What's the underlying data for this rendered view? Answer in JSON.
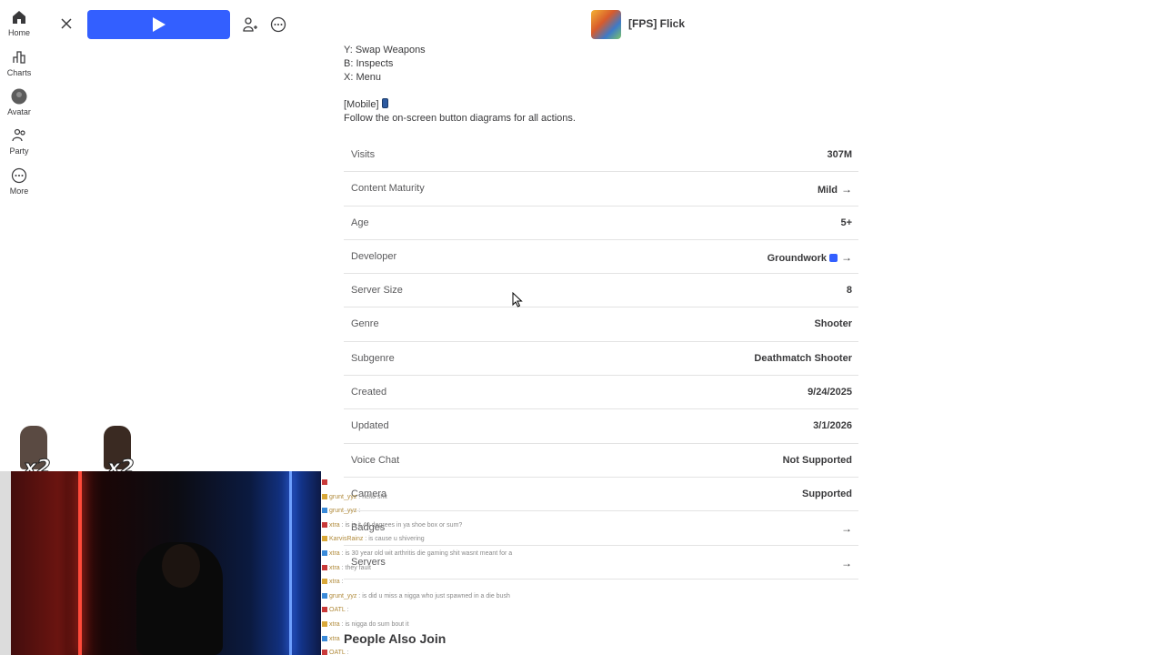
{
  "nav": {
    "items": [
      {
        "label": "Home",
        "icon": "home-icon"
      },
      {
        "label": "Charts",
        "icon": "charts-icon"
      },
      {
        "label": "Avatar",
        "icon": "avatar-icon"
      },
      {
        "label": "Party",
        "icon": "party-icon"
      },
      {
        "label": "More",
        "icon": "more-icon"
      }
    ]
  },
  "topbar": {
    "game_title": "[FPS] Flick",
    "play_color": "#335fff"
  },
  "description": {
    "lines": [
      "Y: Swap Weapons",
      "B: Inspects",
      "X: Menu",
      "",
      "[Mobile]",
      "Follow the on-screen button diagrams for all actions."
    ]
  },
  "info": {
    "rows": [
      {
        "key": "Visits",
        "value": "307M"
      },
      {
        "key": "Content Maturity",
        "value": "Mild"
      },
      {
        "key": "Age",
        "value": "5+"
      },
      {
        "key": "Developer",
        "value": "Groundwork"
      },
      {
        "key": "Server Size",
        "value": "8"
      },
      {
        "key": "Genre",
        "value": "Shooter"
      },
      {
        "key": "Subgenre",
        "value": "Deathmatch Shooter"
      },
      {
        "key": "Created",
        "value": "9/24/2025"
      },
      {
        "key": "Updated",
        "value": "3/1/2026"
      },
      {
        "key": "Voice Chat",
        "value": "Not Supported"
      },
      {
        "key": "Camera",
        "value": "Supported"
      },
      {
        "key": "Badges",
        "value": ""
      },
      {
        "key": "Servers",
        "value": ""
      }
    ]
  },
  "section": {
    "people_also_join": "People Also Join"
  },
  "stream": {
    "multiplier": "x2",
    "chat": [
      {
        "user": "",
        "text": ""
      },
      {
        "user": "grunt_yyz",
        "text": ": hello shit"
      },
      {
        "user": "grunt_yyz",
        "text": ":"
      },
      {
        "user": "xtra",
        "text": ": is is it 40 degrees in ya shoe box or sum?"
      },
      {
        "user": "KarvisRainz",
        "text": ": is cause u shivering"
      },
      {
        "user": "xtra",
        "text": ": is 30 year old wit arthritis die gaming shit wasnt meant for a"
      },
      {
        "user": "xtra",
        "text": ": they fault"
      },
      {
        "user": "xtra",
        "text": ":"
      },
      {
        "user": "grunt_yyz",
        "text": ": is did u miss a nigga who just spawned in a die bush"
      },
      {
        "user": "OATL",
        "text": ":"
      },
      {
        "user": "xtra",
        "text": ": is nigga do sum bout it"
      },
      {
        "user": "xtra",
        "text": ""
      },
      {
        "user": "OATL",
        "text": ":"
      }
    ]
  }
}
